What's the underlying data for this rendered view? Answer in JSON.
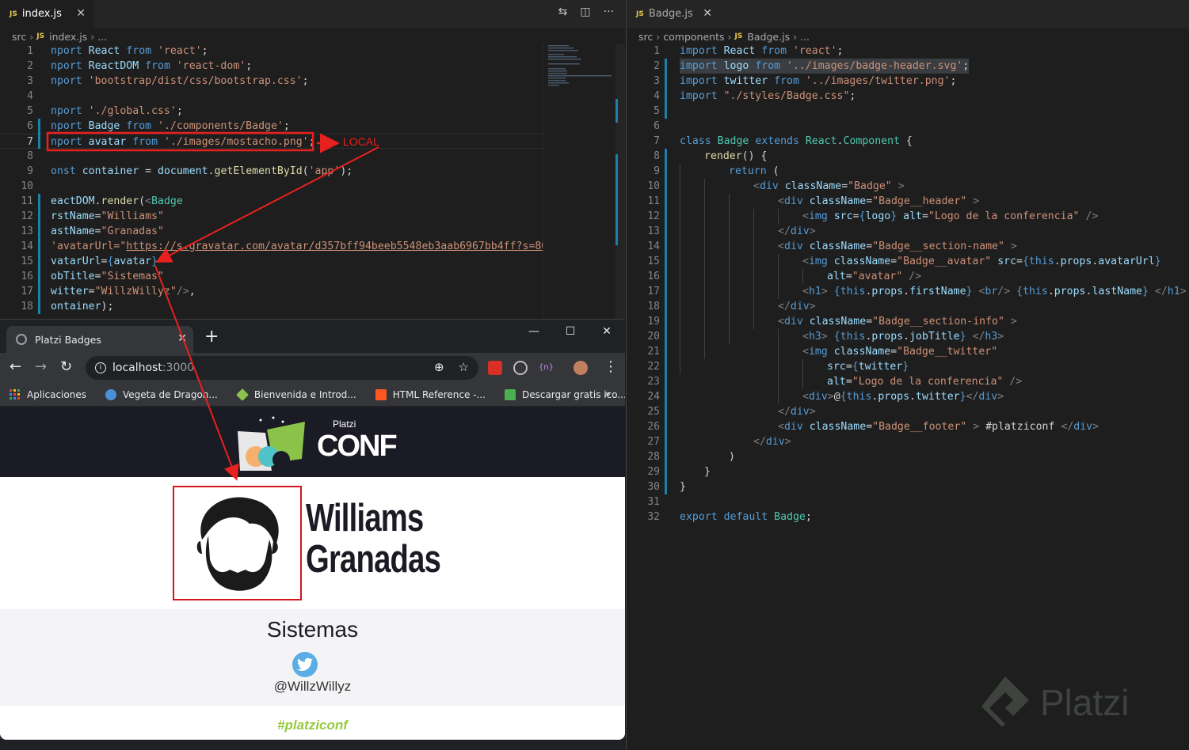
{
  "left_editor": {
    "tab": {
      "icon": "JS",
      "label": "index.js",
      "close": "✕"
    },
    "actions": [
      "⇆",
      "◫",
      "···"
    ],
    "breadcrumb": [
      "src",
      "JS",
      "index.js",
      "..."
    ],
    "line_numbers": [
      "1",
      "2",
      "3",
      "4",
      "5",
      "6",
      "7",
      "8",
      "9",
      "10",
      "11",
      "12",
      "13",
      "14",
      "15",
      "16",
      "17",
      "18"
    ]
  },
  "right_editor": {
    "tab": {
      "icon": "JS",
      "label": "Badge.js",
      "close": "✕"
    },
    "breadcrumb": [
      "src",
      "components",
      "JS",
      "Badge.js",
      "..."
    ],
    "line_numbers": [
      "1",
      "2",
      "3",
      "4",
      "5",
      "6",
      "7",
      "8",
      "9",
      "10",
      "11",
      "12",
      "13",
      "14",
      "15",
      "16",
      "17",
      "18",
      "19",
      "20",
      "21",
      "22",
      "23",
      "24",
      "25",
      "26",
      "27",
      "28",
      "29",
      "30",
      "31",
      "32"
    ]
  },
  "annotation": {
    "local_label": "LOCAL"
  },
  "browser": {
    "tab_title": "Platzi Badges",
    "tab_close": "✕",
    "new_tab": "+",
    "window_controls": [
      "—",
      "☐",
      "✕"
    ],
    "url_host": "localhost",
    "url_port": ":3000",
    "bookmarks": [
      "Aplicaciones",
      "Vegeta de Dragon...",
      "Bienvenida e Introd...",
      "HTML Reference -...",
      "Descargar gratis ico..."
    ],
    "bookmarks_more": "»",
    "bookmark_colors": [
      "#e8453c",
      "#4a90d9",
      "#8bc34a",
      "#ff5722",
      "#4caf50"
    ]
  },
  "badge": {
    "logo_text": "CONF",
    "logo_brand": "Platzi",
    "first_name": "Williams",
    "last_name": "Granadas",
    "job_title": "Sistemas",
    "twitter": "@WillzWillyz",
    "footer": "#platziconf"
  },
  "watermark": "Platzi"
}
